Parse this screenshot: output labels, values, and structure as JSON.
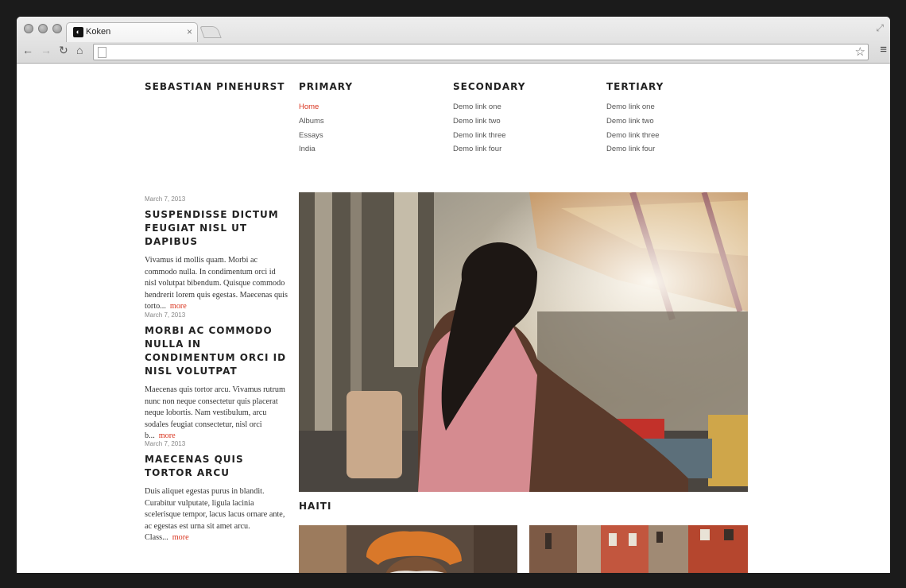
{
  "browser": {
    "tab_title": "Koken",
    "tab_close": "×",
    "favicon": "koken-logo-icon",
    "url": "",
    "back_glyph": "←",
    "forward_glyph": "→",
    "reload_glyph": "↻",
    "home_glyph": "⌂",
    "star_glyph": "☆",
    "menu_glyph": "≡",
    "fullscreen_glyph": "⤢"
  },
  "site": {
    "title": "SEBASTIAN PINEHURST",
    "accent_color": "#d9341f"
  },
  "nav": {
    "primary": {
      "heading": "PRIMARY",
      "links": [
        "Home",
        "Albums",
        "Essays",
        "India"
      ],
      "active": "Home"
    },
    "secondary": {
      "heading": "SECONDARY",
      "links": [
        "Demo link one",
        "Demo link two",
        "Demo link three",
        "Demo link four"
      ]
    },
    "tertiary": {
      "heading": "TERTIARY",
      "links": [
        "Demo link one",
        "Demo link two",
        "Demo link three",
        "Demo link four"
      ]
    }
  },
  "posts": [
    {
      "date": "March 7, 2013",
      "title": "SUSPENDISSE DICTUM FEUGIAT NISL UT DAPIBUS",
      "excerpt": "Vivamus id mollis quam. Morbi ac commodo nulla. In condimentum orci id nisl volutpat bibendum. Quisque commodo hendrerit lorem quis egestas. Maecenas quis torto...",
      "more": "more"
    },
    {
      "date": "March 7, 2013",
      "title": "MORBI AC COMMODO NULLA IN CONDIMENTUM ORCI ID NISL VOLUTPAT",
      "excerpt": "Maecenas quis tortor arcu. Vivamus rutrum nunc non neque consectetur quis placerat neque lobortis. Nam vestibulum, arcu sodales feugiat consectetur, nisl orci b...",
      "more": "more"
    },
    {
      "date": "March 7, 2013",
      "title": "MAECENAS QUIS TORTOR ARCU",
      "excerpt": "Duis aliquet egestas purus in blandit. Curabitur vulputate, ligula lacinia scelerisque tempor, lacus lacus ornare ante, ac egestas est urna sit amet arcu. Class...",
      "more": "more"
    }
  ],
  "featured": {
    "caption": "HAITI"
  }
}
